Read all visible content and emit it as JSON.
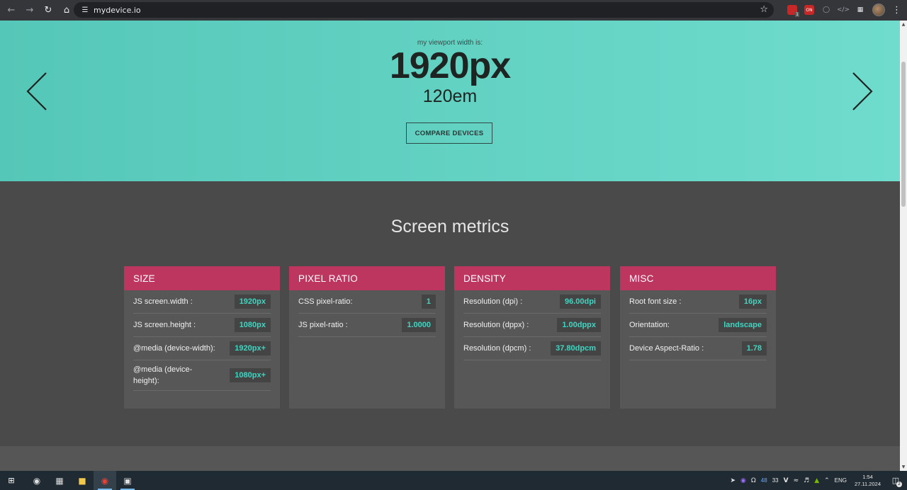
{
  "browser": {
    "url": "mydevice.io",
    "icons": {
      "back": "arrow-left-icon",
      "forward": "arrow-right-icon",
      "reload": "reload-icon",
      "home": "home-icon",
      "site_info": "tune-icon",
      "bookmark": "star-icon",
      "extensions": "puzzle-icon",
      "menu": "kebab-menu-icon"
    },
    "extension_badge": "1"
  },
  "hero": {
    "caption": "my viewport width is:",
    "width_px": "1920px",
    "width_em": "120em",
    "compare_label": "COMPARE DEVICES",
    "background_from": "#55c7b8",
    "background_to": "#6fdccd"
  },
  "metrics": {
    "title": "Screen metrics",
    "accent_color": "#bd3660",
    "value_color": "#3ed6c2",
    "cards": [
      {
        "title": "SIZE",
        "rows": [
          {
            "label": "JS screen.width :",
            "value": "1920px"
          },
          {
            "label": "JS screen.height :",
            "value": "1080px"
          },
          {
            "label": "@media (device-width):",
            "value": "1920px+"
          },
          {
            "label": "@media (device-height):",
            "value": "1080px+"
          }
        ]
      },
      {
        "title": "PIXEL RATIO",
        "rows": [
          {
            "label": "CSS pixel-ratio:",
            "value": "1"
          },
          {
            "label": "JS pixel-ratio :",
            "value": "1.0000"
          }
        ]
      },
      {
        "title": "DENSITY",
        "rows": [
          {
            "label": "Resolution (dpi) :",
            "value": "96.00dpi"
          },
          {
            "label": "Resolution (dppx) :",
            "value": "1.00dppx"
          },
          {
            "label": "Resolution (dpcm) :",
            "value": "37.80dpcm"
          }
        ]
      },
      {
        "title": "MISC",
        "rows": [
          {
            "label": "Root font size :",
            "value": "16px"
          },
          {
            "label": "Orientation:",
            "value": "landscape"
          },
          {
            "label": "Device Aspect-Ratio :",
            "value": "1.78"
          }
        ]
      }
    ]
  },
  "taskbar": {
    "tray": {
      "language": "ENG",
      "count_a": "48",
      "count_b": "33",
      "time": "1:54",
      "date": "27.11.2024",
      "notification_count": "2"
    }
  }
}
